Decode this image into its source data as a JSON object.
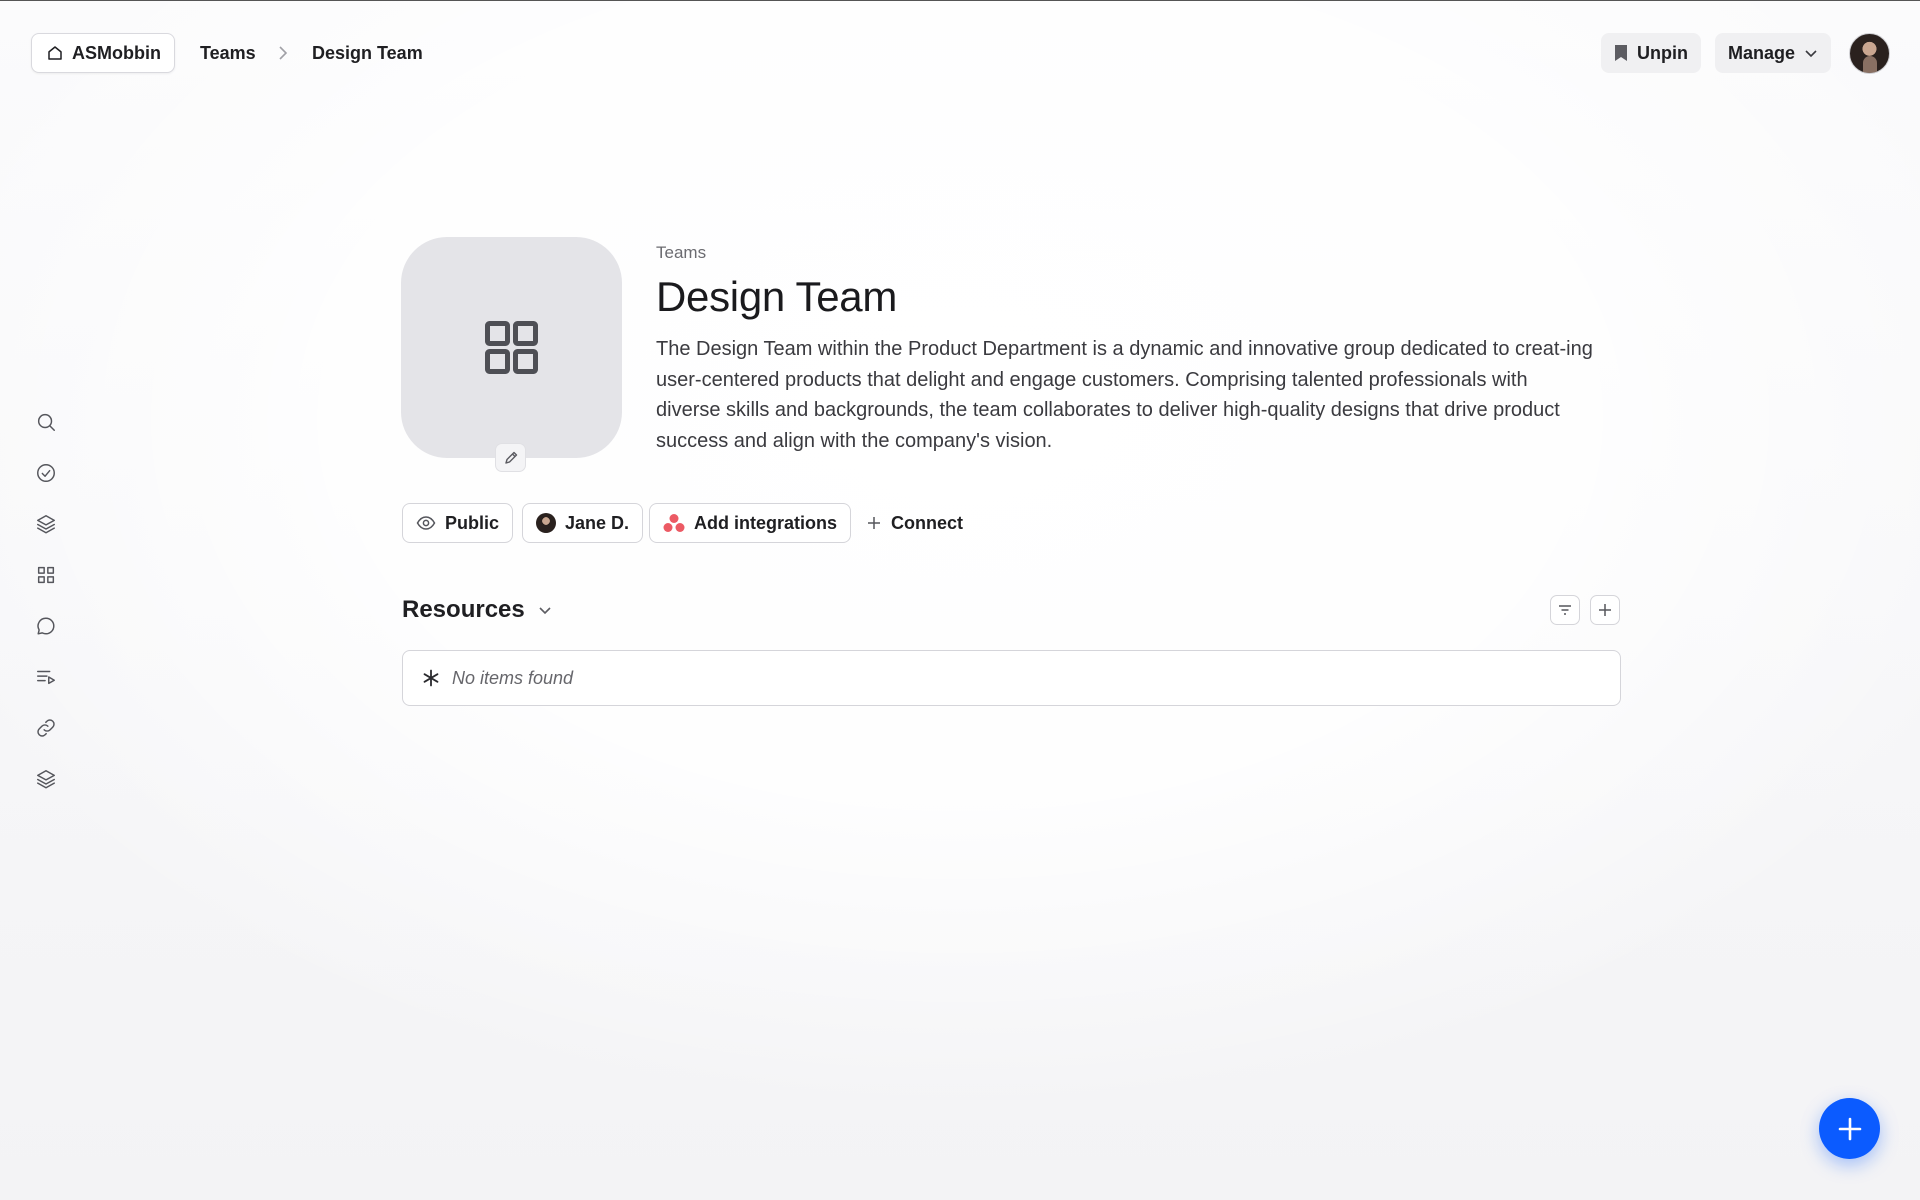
{
  "header": {
    "home_label": "ASMobbin",
    "breadcrumb": [
      "Teams",
      "Design Team"
    ],
    "unpin_label": "Unpin",
    "manage_label": "Manage"
  },
  "sidebar": {
    "icons": [
      "search-icon",
      "check-circle-icon",
      "layers-icon",
      "grid-icon",
      "chat-icon",
      "playlist-icon",
      "link-icon",
      "stack-icon"
    ]
  },
  "team": {
    "eyebrow": "Teams",
    "title": "Design Team",
    "description": "The Design Team within the Product Department is a dynamic and innovative group dedicated to creat-ing user-centered products that delight and engage customers. Comprising talented professionals with diverse skills and backgrounds, the team collaborates to deliver high-quality designs that drive product success and align with the company's vision."
  },
  "chips": {
    "visibility": "Public",
    "owner": "Jane D.",
    "integrations": "Add integrations",
    "connect": "Connect"
  },
  "resources": {
    "title": "Resources",
    "empty_text": "No items found"
  },
  "colors": {
    "accent": "#0b5bff",
    "avatar_tile": "#e4e4e8",
    "integration_red": "#ec5a64"
  }
}
